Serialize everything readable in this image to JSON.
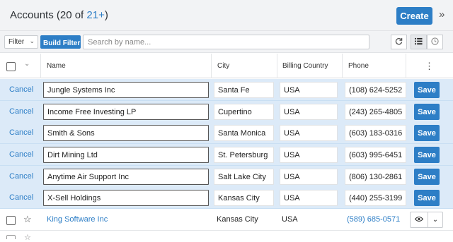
{
  "header": {
    "title_prefix": "Accounts (20 of ",
    "title_link": "21+",
    "title_suffix": ")",
    "create_label": "Create",
    "collapse_glyph": "»"
  },
  "filterbar": {
    "filter_label": "Filter",
    "build_filter_label": "Build Filter",
    "search_placeholder": "Search by name...",
    "search_value": ""
  },
  "table": {
    "columns": [
      "Name",
      "City",
      "Billing Country",
      "Phone"
    ],
    "editing_rows": [
      {
        "cancel": "Cancel",
        "name": "Jungle Systems Inc",
        "city": "Santa Fe",
        "country": "USA",
        "phone": "(108) 624-5252",
        "save": "Save"
      },
      {
        "cancel": "Cancel",
        "name": "Income Free Investing LP",
        "city": "Cupertino",
        "country": "USA",
        "phone": "(243) 265-4805",
        "save": "Save"
      },
      {
        "cancel": "Cancel",
        "name": "Smith & Sons",
        "city": "Santa Monica",
        "country": "USA",
        "phone": "(603) 183-0316",
        "save": "Save"
      },
      {
        "cancel": "Cancel",
        "name": "Dirt Mining Ltd",
        "city": "St. Petersburg",
        "country": "USA",
        "phone": "(603) 995-6451",
        "save": "Save"
      },
      {
        "cancel": "Cancel",
        "name": "Anytime Air Support Inc",
        "city": "Salt Lake City",
        "country": "USA",
        "phone": "(806) 130-2861",
        "save": "Save"
      },
      {
        "cancel": "Cancel",
        "name": "X-Sell Holdings",
        "city": "Kansas City",
        "country": "USA",
        "phone": "(440) 255-3199",
        "save": "Save"
      }
    ],
    "normal_row": {
      "name": "King Software Inc",
      "city": "Kansas City",
      "country": "USA",
      "phone": "(589) 685-0571"
    }
  },
  "icons": {
    "refresh": "refresh-icon",
    "list_view": "list-icon",
    "clock": "clock-icon",
    "kebab": "kebab-icon",
    "star": "star-icon",
    "eye": "eye-icon",
    "chevron": "chevron-down-icon"
  },
  "colors": {
    "accent": "#2d7ec6",
    "edit_row_bg": "#dceaf8",
    "header_bg": "#f2f3f5"
  }
}
